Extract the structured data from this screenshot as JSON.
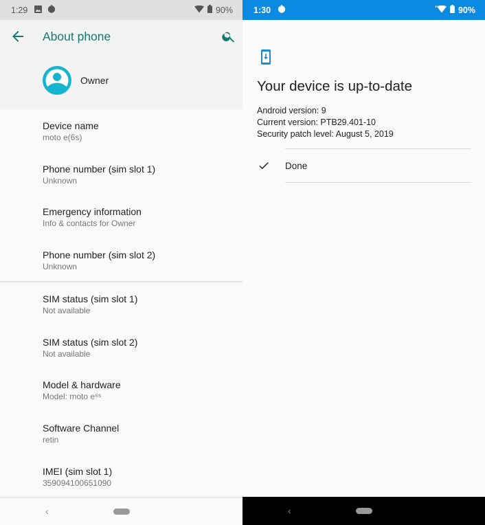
{
  "left_screen": {
    "status_bar": {
      "time": "1:29",
      "icons": [
        "image-icon",
        "motorola-icon"
      ],
      "right_icons": [
        "wifi-icon",
        "battery-icon"
      ],
      "battery": "90%"
    },
    "app_bar": {
      "title": "About phone",
      "back_icon": "arrow-back-icon",
      "search_icon": "search-icon",
      "accent_color": "#147a6e"
    },
    "owner": {
      "name": "Owner",
      "avatar_color": "#17b4d0"
    },
    "items_group1": [
      {
        "title": "Device name",
        "summary": "moto e(6s)"
      },
      {
        "title": "Phone number (sim slot 1)",
        "summary": "Unknown"
      },
      {
        "title": "Emergency information",
        "summary": "Info & contacts for Owner"
      },
      {
        "title": "Phone number (sim slot 2)",
        "summary": "Unknown"
      }
    ],
    "items_group2": [
      {
        "title": "SIM status (sim slot 1)",
        "summary": "Not available"
      },
      {
        "title": "SIM status (sim slot 2)",
        "summary": "Not available"
      },
      {
        "title": "Model & hardware",
        "summary": "Model: moto e⁶ˢ"
      },
      {
        "title": "Software Channel",
        "summary": "retin"
      },
      {
        "title": "IMEI (sim slot 1)",
        "summary": "359094100651090"
      }
    ],
    "nav": {
      "back": "‹"
    }
  },
  "right_screen": {
    "status_bar": {
      "time": "1:30",
      "icons": [
        "motorola-icon"
      ],
      "right_icons": [
        "wifi-icon",
        "battery-icon"
      ],
      "battery": "90%",
      "color": "#0a8ae0"
    },
    "icon": "system-update-icon",
    "title": "Your device is up-to-date",
    "info_lines": [
      "Android version: 9",
      "Current version: PTB29.401-10",
      "Security patch level: August 5, 2019"
    ],
    "done_label": "Done",
    "nav": {
      "back": "‹"
    }
  }
}
